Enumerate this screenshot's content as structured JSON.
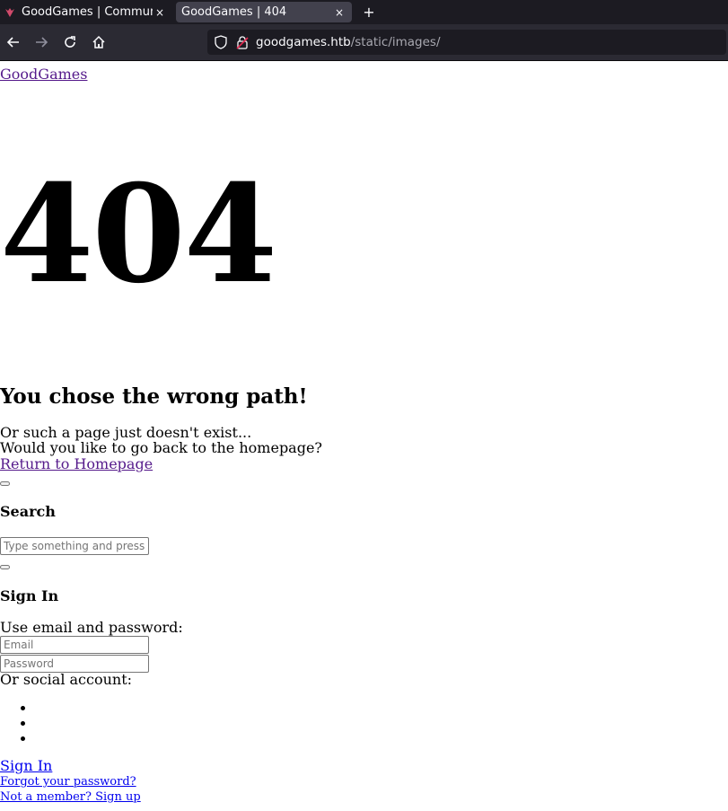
{
  "browser": {
    "tabs": [
      {
        "title": "GoodGames | Community and Store",
        "close": "×"
      },
      {
        "title": "GoodGames | 404",
        "close": "×"
      }
    ],
    "new_tab": "+",
    "url_host": "goodgames.htb",
    "url_path": "/static/images/"
  },
  "page": {
    "logo_text": "GoodGames",
    "error_code": "404",
    "heading": "You chose the wrong path!",
    "desc_line1": "Or such a page just doesn't exist...",
    "desc_line2": "Would you like to go back to the homepage?",
    "return_link": "Return to Homepage"
  },
  "search": {
    "heading": "Search",
    "placeholder": "Type something and press Enter"
  },
  "signin": {
    "heading": "Sign In",
    "prompt": "Use email and password:",
    "email_placeholder": "Email",
    "password_placeholder": "Password",
    "social_label": "Or social account:",
    "social_items": [
      "",
      "",
      ""
    ],
    "signin_link": "Sign In",
    "forgot_link": "Forgot your password?",
    "signup_link": "Not a member? Sign up"
  },
  "colors": {
    "tabbar": "#1c1b22",
    "toolbar": "#2b2a33",
    "visited_link": "#551a8b",
    "link": "#0000ee",
    "favicon": "#d14a6b"
  }
}
